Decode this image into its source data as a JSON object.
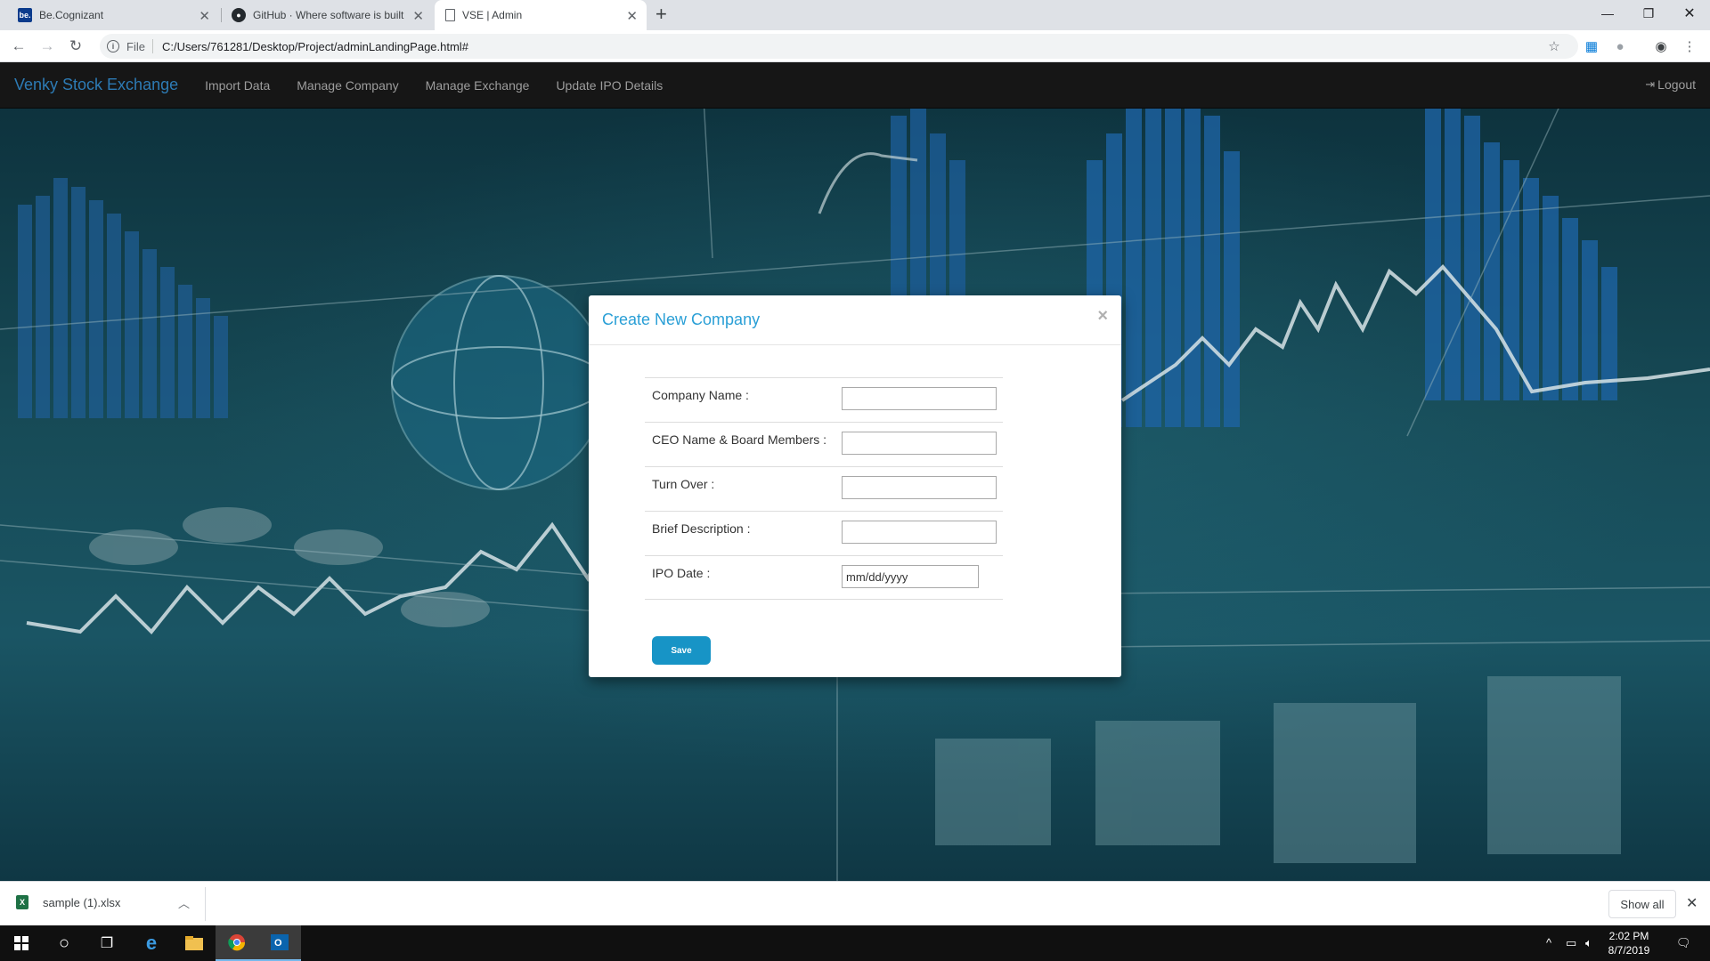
{
  "browser": {
    "tabs": [
      {
        "title": "Be.Cognizant",
        "icon": "becognizant-icon",
        "fav_text": "be."
      },
      {
        "title": "GitHub · Where software is built",
        "icon": "github-icon"
      },
      {
        "title": "VSE | Admin",
        "icon": "page-icon",
        "active": true
      }
    ],
    "address": {
      "scheme_label": "File",
      "url": "C:/Users/761281/Desktop/Project/adminLandingPage.html#"
    }
  },
  "app": {
    "brand": "Venky Stock Exchange",
    "nav": {
      "import_data": "Import Data",
      "manage_company": "Manage Company",
      "manage_exchange": "Manage Exchange",
      "update_ipo": "Update IPO Details"
    },
    "logout": "Logout",
    "colors": {
      "brand": "#2d7bb5",
      "modal_title": "#2a9fd6",
      "save_button": "#1794c6",
      "navbar": "#161616"
    }
  },
  "modal": {
    "title": "Create New Company",
    "close": "×",
    "fields": {
      "company_name": {
        "label": "Company Name :",
        "value": ""
      },
      "ceo": {
        "label": "CEO Name & Board Members :",
        "value": ""
      },
      "turnover": {
        "label": "Turn Over :",
        "value": ""
      },
      "description": {
        "label": "Brief Description :",
        "value": ""
      },
      "ipo_date": {
        "label": "IPO Date :",
        "value": "mm/dd/yyyy"
      }
    },
    "save_label": "Save"
  },
  "downloads": {
    "file": "sample (1).xlsx",
    "show_all": "Show all"
  },
  "taskbar": {
    "time": "2:02 PM",
    "date": "8/7/2019"
  }
}
